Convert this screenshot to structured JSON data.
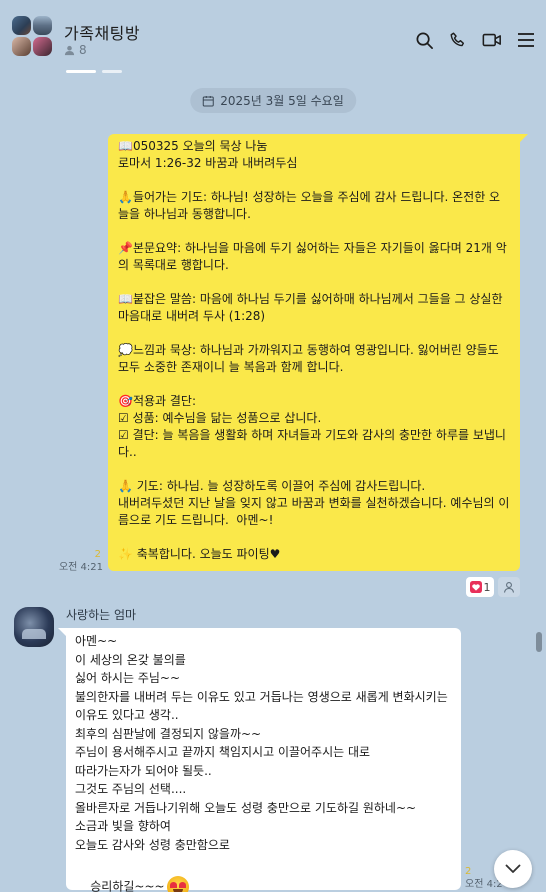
{
  "header": {
    "title": "가족채팅방",
    "member_count": "8",
    "corner_mark": "• • •"
  },
  "date_divider": "2025년 3월 5일 수요일",
  "my_message": {
    "lines": [
      "📖050325 오늘의 묵상 나눔",
      "로마서 1:26-32 바꿈과 내버려두심",
      "",
      "🙏들어가는 기도: 하나님! 성장하는 오늘을 주심에 감사 드립니다. 온전한 오늘을 하나님과 동행합니다.",
      "",
      "📌본문요약: 하나님을 마음에 두기 싫어하는 자들은 자기들이 옳다며 21개 악의 목록대로 행합니다.",
      "",
      "📖붙잡은 말씀: 마음에 하나님 두기를 싫어하매 하나님께서 그들을 그 상실한 마음대로 내버려 두사 (1:28)",
      "",
      "💭느낌과 묵상: 하나님과 가까워지고 동행하여 영광입니다. 잃어버린 양들도 모두 소중한 존재이니 늘 복음과 함께 합니다.",
      "",
      "🎯적용과 결단:",
      "☑ 성품: 예수님을 닮는 성품으로 삽니다.",
      "☑ 결단: 늘 복음을 생활화 하며 자녀들과 기도와 감사의 충만한 하루를 보냅니다..",
      "",
      "🙏 기도: 하나님. 늘 성장하도록 이끌어 주심에 감사드립니다.",
      "내버려두셨던 지난 날을 잊지 않고 바꿈과 변화를 실천하겠습니다. 예수님의 이름으로 기도 드립니다.  아멘~!",
      "",
      "✨ 축복합니다. 오늘도 파이팅♥"
    ],
    "unread": "2",
    "time": "오전 4:21",
    "reaction_count": "1"
  },
  "other_message": {
    "sender": "사랑하는 엄마",
    "lines": [
      "아멘~~",
      "이 세상의 온갖 불의를",
      "싫어 하시는 주님~~",
      "불의한자를 내버려 두는 이유도 있고 거듭나는 영생으로 새롭게 변화시키는",
      "이유도 있다고 생각..",
      "최후의 심판날에 결정되지 않을까~~",
      "주님이 용서해주시고 끝까지 책임지시고 이끌어주시는 대로",
      "따라가는자가 되어야 될듯..",
      "그것도 주님의 선택....",
      "올바른자로 거듭나기위해 오늘도 성령 충만으로 기도하길 원하네~~",
      "소금과 빛을 향하여",
      "오늘도 감사와 성령 충만함으로"
    ],
    "last_line": "승리하길~~~",
    "unread": "2",
    "time": "오전 4:2"
  },
  "icons": [
    "search-icon",
    "phone-icon",
    "video-icon",
    "menu-icon",
    "calendar-icon",
    "heart-icon",
    "add-reaction-icon",
    "chevron-down-icon",
    "person-icon",
    "love-eyes-emoji"
  ],
  "colors": {
    "background": "#bacee0",
    "my_bubble": "#fae84a",
    "other_bubble": "#ffffff",
    "reaction_heart": "#e8305a"
  }
}
